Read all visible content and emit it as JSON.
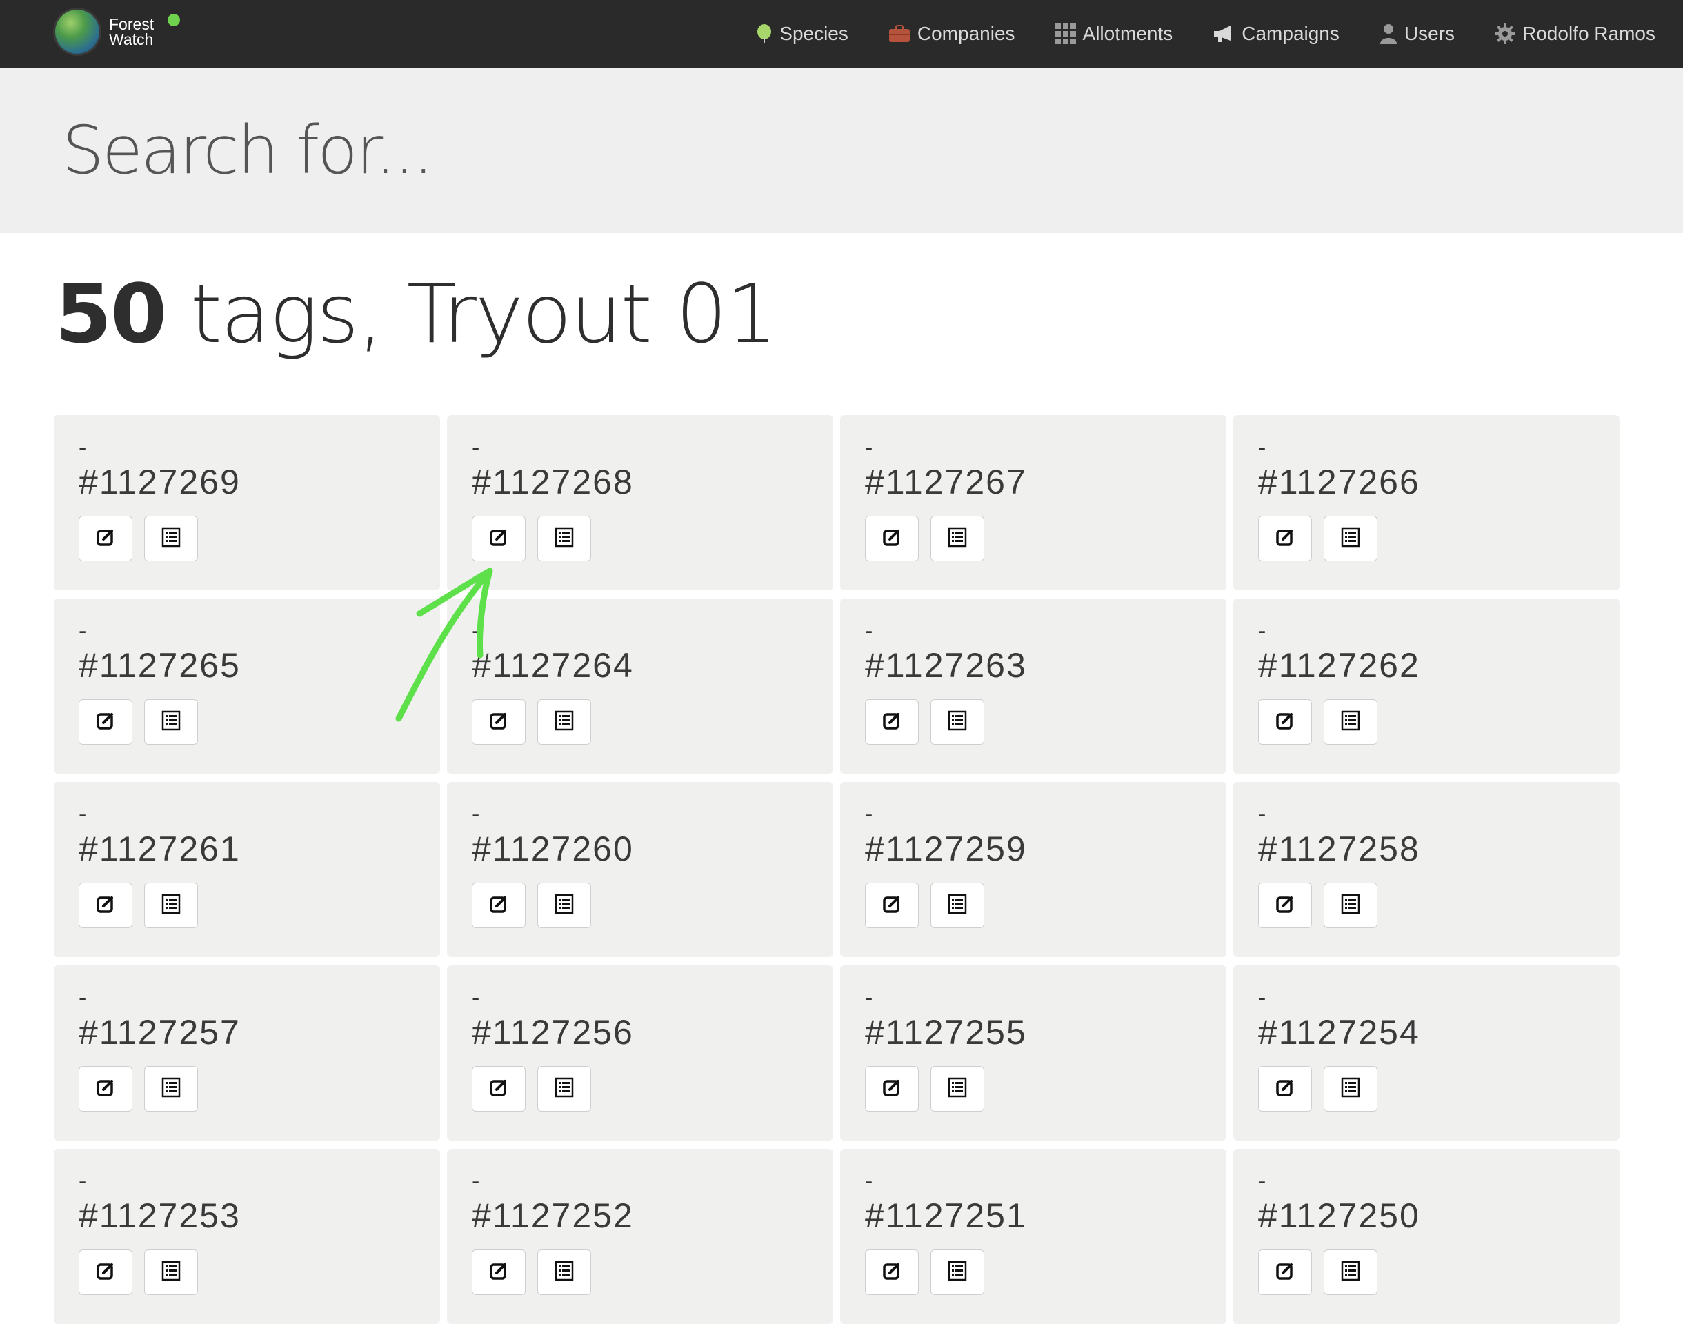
{
  "app": {
    "logo_line1": "Forest",
    "logo_line2": "Watch",
    "accent_color": "#6ed24f"
  },
  "nav": {
    "items": [
      {
        "label": "Species",
        "icon": "tree-icon"
      },
      {
        "label": "Companies",
        "icon": "briefcase-icon"
      },
      {
        "label": "Allotments",
        "icon": "grid-icon"
      },
      {
        "label": "Campaigns",
        "icon": "megaphone-icon"
      },
      {
        "label": "Users",
        "icon": "user-icon"
      },
      {
        "label": "Rodolfo Ramos",
        "icon": "gear-icon"
      }
    ]
  },
  "search": {
    "placeholder": "Search for..."
  },
  "heading": {
    "count": "50",
    "rest": " tags, Tryout 01"
  },
  "cards": [
    {
      "dash": "-",
      "id": "#1127269"
    },
    {
      "dash": "-",
      "id": "#1127268"
    },
    {
      "dash": "-",
      "id": "#1127267"
    },
    {
      "dash": "-",
      "id": "#1127266"
    },
    {
      "dash": "-",
      "id": "#1127265"
    },
    {
      "dash": "-",
      "id": "#1127264"
    },
    {
      "dash": "-",
      "id": "#1127263"
    },
    {
      "dash": "-",
      "id": "#1127262"
    },
    {
      "dash": "-",
      "id": "#1127261"
    },
    {
      "dash": "-",
      "id": "#1127260"
    },
    {
      "dash": "-",
      "id": "#1127259"
    },
    {
      "dash": "-",
      "id": "#1127258"
    },
    {
      "dash": "-",
      "id": "#1127257"
    },
    {
      "dash": "-",
      "id": "#1127256"
    },
    {
      "dash": "-",
      "id": "#1127255"
    },
    {
      "dash": "-",
      "id": "#1127254"
    },
    {
      "dash": "-",
      "id": "#1127253"
    },
    {
      "dash": "-",
      "id": "#1127252"
    },
    {
      "dash": "-",
      "id": "#1127251"
    },
    {
      "dash": "-",
      "id": "#1127250"
    }
  ],
  "annotation": {
    "color": "#5ee04a"
  }
}
